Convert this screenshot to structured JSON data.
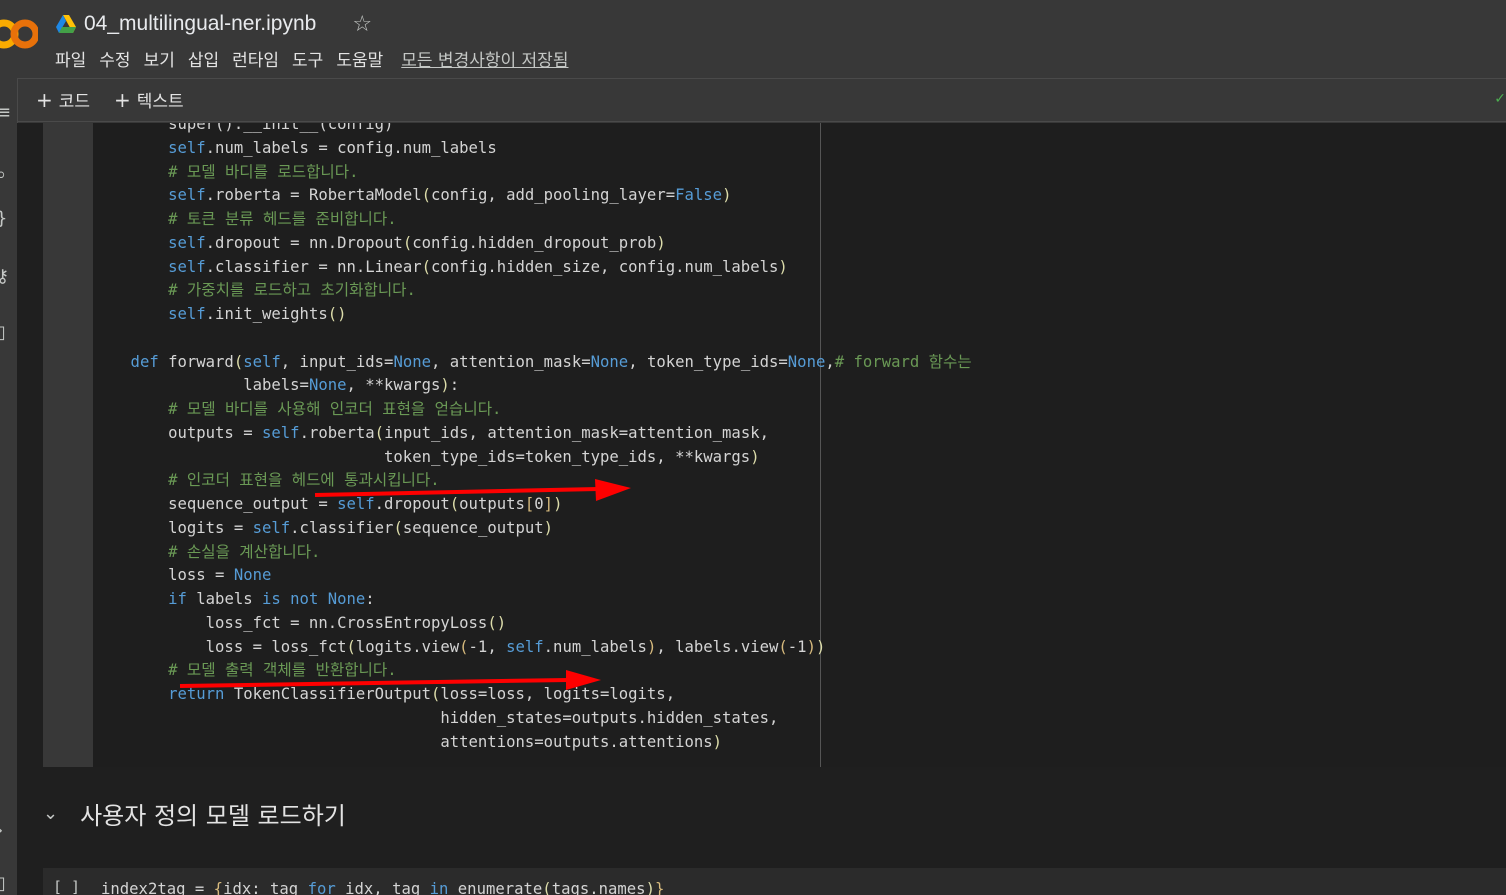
{
  "header": {
    "title": "04_multilingual-ner.ipynb",
    "menu": [
      "파일",
      "수정",
      "보기",
      "삽입",
      "런타임",
      "도구",
      "도움말"
    ],
    "saved_status": "모든 변경사항이 저장됨"
  },
  "toolbar": {
    "add_code": "코드",
    "add_text": "텍스트"
  },
  "icons": {
    "logo": "colab-logo",
    "drive": "drive-icon",
    "star": "star-icon",
    "plus": "plus-icon",
    "check": "check-icon",
    "chevron": "chevron-down-icon"
  },
  "colors": {
    "keyword": "#569cd6",
    "comment": "#6a9955",
    "arrow": "#ff0000",
    "editor_bg": "#1e1e1e"
  },
  "code_lines": [
    "        super().__init__(config)",
    "        self.num_labels = config.num_labels",
    "        # 모델 바디를 로드합니다.",
    "        self.roberta = RobertaModel(config, add_pooling_layer=False)",
    "        # 토큰 분류 헤드를 준비합니다.",
    "        self.dropout = nn.Dropout(config.hidden_dropout_prob)",
    "        self.classifier = nn.Linear(config.hidden_size, config.num_labels)",
    "        # 가중치를 로드하고 초기화합니다.",
    "        self.init_weights()",
    "",
    "    def forward(self, input_ids=None, attention_mask=None, token_type_ids=None,# forward 함수는",
    "                labels=None, **kwargs):",
    "        # 모델 바디를 사용해 인코더 표현을 얻습니다.",
    "        outputs = self.roberta(input_ids, attention_mask=attention_mask,",
    "                               token_type_ids=token_type_ids, **kwargs)",
    "        # 인코더 표현을 헤드에 통과시킵니다.",
    "        sequence_output = self.dropout(outputs[0])",
    "        logits = self.classifier(sequence_output)",
    "        # 손실을 계산합니다.",
    "        loss = None",
    "        if labels is not None:",
    "            loss_fct = nn.CrossEntropyLoss()",
    "            loss = loss_fct(logits.view(-1, self.num_labels), labels.view(-1))",
    "        # 모델 출력 객체를 반환합니다.",
    "        return TokenClassifierOutput(loss=loss, logits=logits,",
    "                                     hidden_states=outputs.hidden_states,",
    "                                     attentions=outputs.attentions)"
  ],
  "section": {
    "title": "사용자 정의 모델 로드하기"
  },
  "next_cell": {
    "run_indicator": "[ ]",
    "code": "index2tag = {idx: tag for idx, tag in enumerate(tags.names)}"
  }
}
